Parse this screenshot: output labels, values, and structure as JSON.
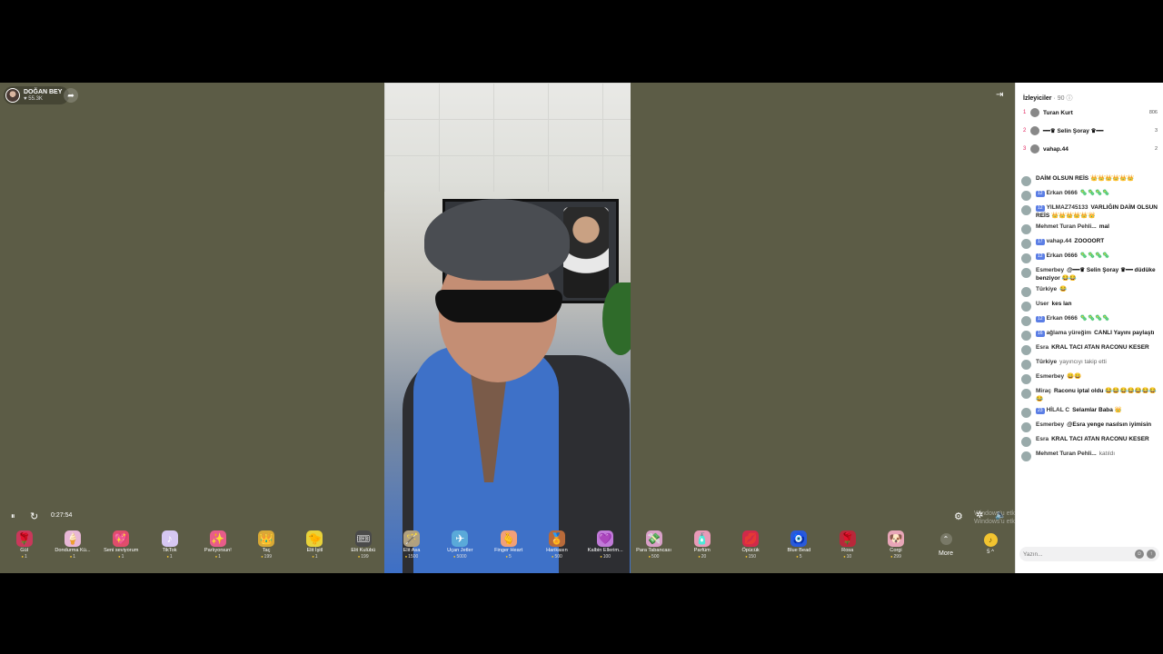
{
  "host": {
    "name": "DOĞAN BEY",
    "likes": "♥ 55.3K"
  },
  "player": {
    "time": "0:27:54",
    "pause_icon": "⏸",
    "refresh_icon": "↻"
  },
  "watermark": {
    "line1": "Windows'u etkinleştir",
    "line2": "Windows'u etkinleştirmek için Ayarlar'a gidin."
  },
  "gifts": [
    {
      "name": "Gül",
      "price": "1",
      "icon": "🌹",
      "color": "#c9385a"
    },
    {
      "name": "Dondurma Kü...",
      "price": "1",
      "icon": "🍦",
      "color": "#e8b7d6"
    },
    {
      "name": "Seni seviyorum",
      "price": "1",
      "icon": "💖",
      "color": "#e04d6b"
    },
    {
      "name": "TikTok",
      "price": "1",
      "icon": "♪",
      "color": "#d6c7f2"
    },
    {
      "name": "Parlıyorsun!",
      "price": "1",
      "icon": "✨",
      "color": "#e85c8a"
    },
    {
      "name": "Taç",
      "price": "199",
      "icon": "👑",
      "color": "#d8a935"
    },
    {
      "name": "Elit İşitl",
      "price": "1",
      "icon": "🐤",
      "color": "#e8d23a"
    },
    {
      "name": "Elit Kulübü",
      "price": "199",
      "icon": "🎟",
      "color": "#4a4a4a"
    },
    {
      "name": "Elit Asa",
      "price": "1500",
      "icon": "🪄",
      "color": "#b0a080"
    },
    {
      "name": "Uçan Jetler",
      "price": "5000",
      "icon": "✈",
      "color": "#5aa9d9"
    },
    {
      "name": "Finger Heart",
      "price": "5",
      "icon": "🫰",
      "color": "#f1a07a"
    },
    {
      "name": "Harikasın",
      "price": "500",
      "icon": "🏅",
      "color": "#b86a3a"
    },
    {
      "name": "Kalbin Ellerim...",
      "price": "100",
      "icon": "💜",
      "color": "#c07ad8"
    },
    {
      "name": "Para Tabancası",
      "price": "500",
      "icon": "💸",
      "color": "#d9a0c8"
    },
    {
      "name": "Parfüm",
      "price": "20",
      "icon": "🧴",
      "color": "#e99ab8"
    },
    {
      "name": "Öpücük",
      "price": "150",
      "icon": "💋",
      "color": "#d02a4a"
    },
    {
      "name": "Blue Bead",
      "price": "5",
      "icon": "🧿",
      "color": "#2a5ad8"
    },
    {
      "name": "Rosa",
      "price": "10",
      "icon": "🌹",
      "color": "#b8283a"
    },
    {
      "name": "Corgi",
      "price": "299",
      "icon": "🐶",
      "color": "#e8a6b8"
    }
  ],
  "more_label": "More",
  "coins": {
    "count": "5",
    "suffix": "^"
  },
  "viewers": {
    "title": "İzleyiciler",
    "count": "· 90",
    "top": [
      {
        "rank": "1",
        "name": "Turan Kurt",
        "score": "806"
      },
      {
        "rank": "2",
        "name": "━━♛ Selin Şoray ♛━━",
        "score": "3"
      },
      {
        "rank": "3",
        "name": "vahap.44",
        "score": "2"
      }
    ]
  },
  "chat": [
    {
      "badge": "",
      "who": "",
      "text": "DAİM OLSUN REİS 👑👑👑👑👑👑",
      "sys": false
    },
    {
      "badge": "12",
      "who": "Erkan 0666",
      "text": "🦠🦠🦠🦠",
      "sys": false
    },
    {
      "badge": "12",
      "who": "YILMAZ745133",
      "text": "VARLIĞIN DAİM OLSUN REİS 👑👑👑👑👑👑",
      "sys": false
    },
    {
      "badge": "",
      "who": "Mehmet Turan Pehli...",
      "text": "mal",
      "sys": false
    },
    {
      "badge": "17",
      "who": "vahap.44",
      "text": "ZOOOORT",
      "sys": false
    },
    {
      "badge": "12",
      "who": "Erkan 0666",
      "text": "🦠🦠🦠🦠",
      "sys": false
    },
    {
      "badge": "",
      "who": "Esmerbey",
      "text": "@━━♛ Selin Şoray ♛━━ düdüke benziyor 😂😂",
      "sys": false
    },
    {
      "badge": "",
      "who": "Türkiye",
      "text": "😂",
      "sys": false
    },
    {
      "badge": "",
      "who": "User",
      "text": "kes lan",
      "sys": false
    },
    {
      "badge": "12",
      "who": "Erkan 0666",
      "text": "🦠🦠🦠🦠",
      "sys": false
    },
    {
      "badge": "16",
      "who": "ağlama yüreğim",
      "text": "CANLI Yayını paylaştı",
      "sys": false
    },
    {
      "badge": "",
      "who": "Esra",
      "text": "KRAL TACI ATAN RACONU KESER",
      "sys": false
    },
    {
      "badge": "",
      "who": "Türkiye",
      "text": "yayıncıyı takip etti",
      "sys": true
    },
    {
      "badge": "",
      "who": "Esmerbey",
      "text": "😀😀",
      "sys": false
    },
    {
      "badge": "",
      "who": "Miraç",
      "text": "Raconu iptal oldu 😂😂😂😂😂😂😂😂",
      "sys": false
    },
    {
      "badge": "23",
      "who": "HİLAL C",
      "text": "Selamlar Baba 👑",
      "sys": false
    },
    {
      "badge": "",
      "who": "Esmerbey",
      "text": "@Esra yenge nasılsın iyimisin",
      "sys": false
    },
    {
      "badge": "",
      "who": "Esra",
      "text": "KRAL TACI ATAN RACONU KESER",
      "sys": false
    },
    {
      "badge": "",
      "who": "Mehmet Turan Pehli...",
      "text": "katıldı",
      "sys": true
    }
  ],
  "input": {
    "placeholder": "Yazın..."
  }
}
